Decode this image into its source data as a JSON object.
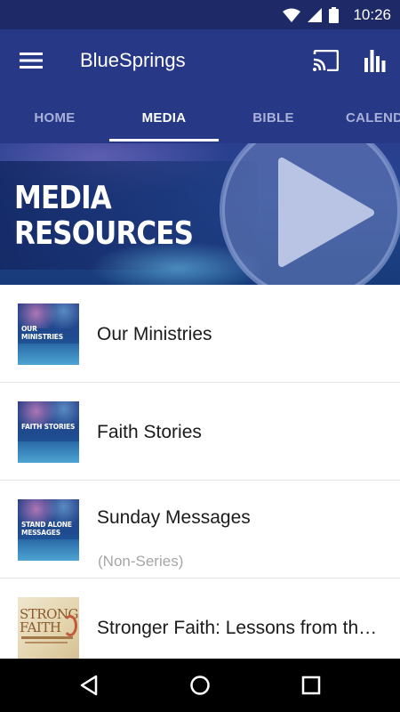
{
  "status_bar": {
    "time": "10:26",
    "icons": [
      "wifi-icon",
      "signal-icon",
      "battery-icon"
    ]
  },
  "app_bar": {
    "title": "BlueSprings",
    "icons": [
      "hamburger-menu-icon",
      "cast-icon",
      "bar-chart-icon"
    ],
    "background": "#273887"
  },
  "tabs": {
    "items": [
      {
        "label": "HOME"
      },
      {
        "label": "MEDIA"
      },
      {
        "label": "BIBLE"
      },
      {
        "label": "CALENDAR"
      }
    ],
    "selected": "MEDIA"
  },
  "banner": {
    "title_line1": "MEDIA",
    "title_line2": "RESOURCES",
    "icon": "play-icon"
  },
  "list": {
    "items": [
      {
        "thumb_text": "OUR MINISTRIES",
        "title": "Our Ministries",
        "subtitle": ""
      },
      {
        "thumb_text": "FAITH STORIES",
        "title": "Faith Stories",
        "subtitle": ""
      },
      {
        "thumb_text": "STAND ALONE MESSAGES",
        "title": "Sunday Messages",
        "subtitle": "(Non-Series)"
      },
      {
        "thumb_text": "STRONGER FAITH",
        "title": "Stronger Faith:  Lessons from the Life of Joseph",
        "subtitle": ""
      }
    ]
  },
  "nav_bar": {
    "icons": [
      "back-icon",
      "home-icon",
      "recents-icon"
    ]
  }
}
